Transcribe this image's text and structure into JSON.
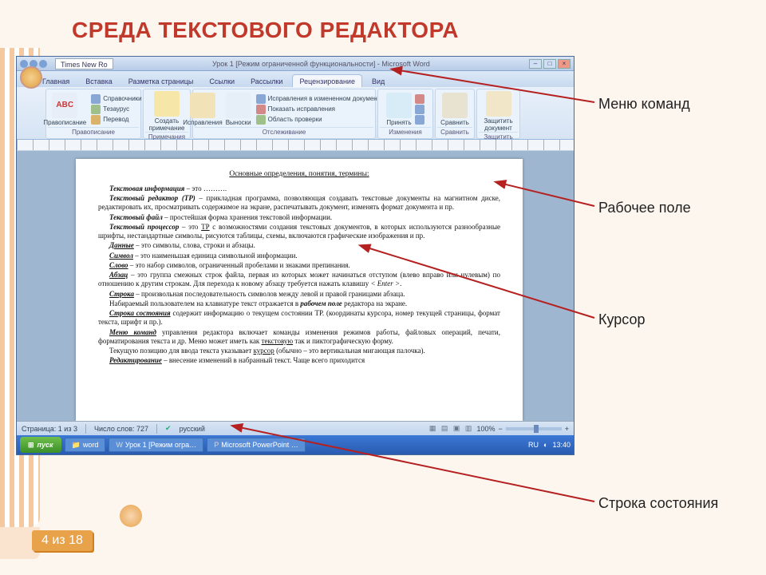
{
  "slide": {
    "title": "СРЕДА ТЕКСТОВОГО РЕДАКТОРА",
    "page_number": "4 из 18"
  },
  "callouts": {
    "menu": "Меню команд",
    "workarea": "Рабочее поле",
    "cursor": "Курсор",
    "statusbar": "Строка состояния"
  },
  "word": {
    "font_name": "Times New Ro",
    "window_title": "Урок 1 [Режим ограниченной функциональности] - Microsoft Word",
    "tabs": {
      "home": "Главная",
      "insert": "Вставка",
      "layout": "Разметка страницы",
      "references": "Ссылки",
      "mailings": "Рассылки",
      "review": "Рецензирование",
      "view": "Вид"
    },
    "ribbon": {
      "proofing": {
        "caption": "Правописание",
        "spell": "ABC",
        "spell_label": "Правописание",
        "research": "Справочники",
        "thesaurus": "Тезаурус",
        "translate": "Перевод"
      },
      "comments": {
        "caption": "Примечания",
        "new": "Создать примечание"
      },
      "tracking": {
        "caption": "Отслеживание",
        "track": "Исправления",
        "balloons": "Выноски",
        "show1": "Исправления в измененном документе",
        "show2": "Показать исправления",
        "show3": "Область проверки"
      },
      "changes": {
        "caption": "Изменения",
        "accept": "Принять",
        "prev": "",
        "next": ""
      },
      "compare": {
        "caption": "Сравнить",
        "compare": "Сравнить"
      },
      "protect": {
        "caption": "Защитить",
        "protect": "Защитить документ"
      }
    },
    "document": {
      "title": "Основные определения, понятия, термины:",
      "p1a": "Текстовая информация",
      "p1b": " – это ……….",
      "p2a": "Текстовый редактор (ТР)",
      "p2b": " – прикладная программа, позволяющая создавать текстовые документы на магнитном диске, редактировать их, просматривать содержимое на экране, распечатывать документ, изменять формат документа и пр.",
      "p3a": "Текстовый файл",
      "p3b": " – простейшая форма хранения текстовой информации.",
      "p4a": "Текстовый процессор",
      "p4b": " – это ",
      "p4u": "ТР",
      "p4c": " с возможностями создания текстовых документов, в которых используются разнообразные шрифты, нестандартные символы, рисуются таблицы, схемы, включаются графические изображения и пр.",
      "p5a": "Данные",
      "p5b": " – это символы, слова, строки и абзацы.",
      "p6a": "Символ",
      "p6b": " – это наименьшая единица символьной информации.",
      "p7a": "Слово",
      "p7b": " – это набор символов, ограниченный пробелами и знаками препинания.",
      "p8a": "Абзац",
      "p8b": " – это группа смежных строк файла, первая из которых может начинаться отступом (влево вправо или нулевым) по отношению к другим строкам. Для перехода к новому абзацу требуется нажать клавишу ",
      "p8i": "< Enter >",
      "p8c": ".",
      "p9a": "Строка",
      "p9b": " – произвольная последовательность символов между левой и правой границами абзаца.",
      "p10": "Набираемый пользователем на клавиатуре текст отражается в ",
      "p10i": "рабочем поле",
      "p10b": " редактора на экране.",
      "p11a": "Строка состояния",
      "p11b": " содержит информацию о текущем состоянии ТР. (координаты курсора, номер текущей страницы, формат текста, шрифт и пр.).",
      "p12a": "Меню команд",
      "p12b": " управления редактора включает команды изменения режимов работы, файловых операций, печати, форматирования текста и др. Меню может иметь как ",
      "p12u": "текстовую",
      "p12c": " так и пиктографическую форму.",
      "p13a": "Текущую позицию для ввода текста указывает ",
      "p13u": "курсор",
      "p13b": " (обычно – это вертикальная мигающая палочка).",
      "p14a": "Редактирование",
      "p14b": " – внесение изменений в набранный текст. Чаще всего приходится"
    },
    "status": {
      "page": "Страница: 1 из 3",
      "words": "Число слов: 727",
      "lang": "русский",
      "zoom": "100%"
    },
    "taskbar": {
      "start": "пуск",
      "task1": "word",
      "task2": "Урок 1 [Режим огра…",
      "task3": "Microsoft PowerPoint …",
      "lang": "RU",
      "time": "13:40"
    }
  }
}
